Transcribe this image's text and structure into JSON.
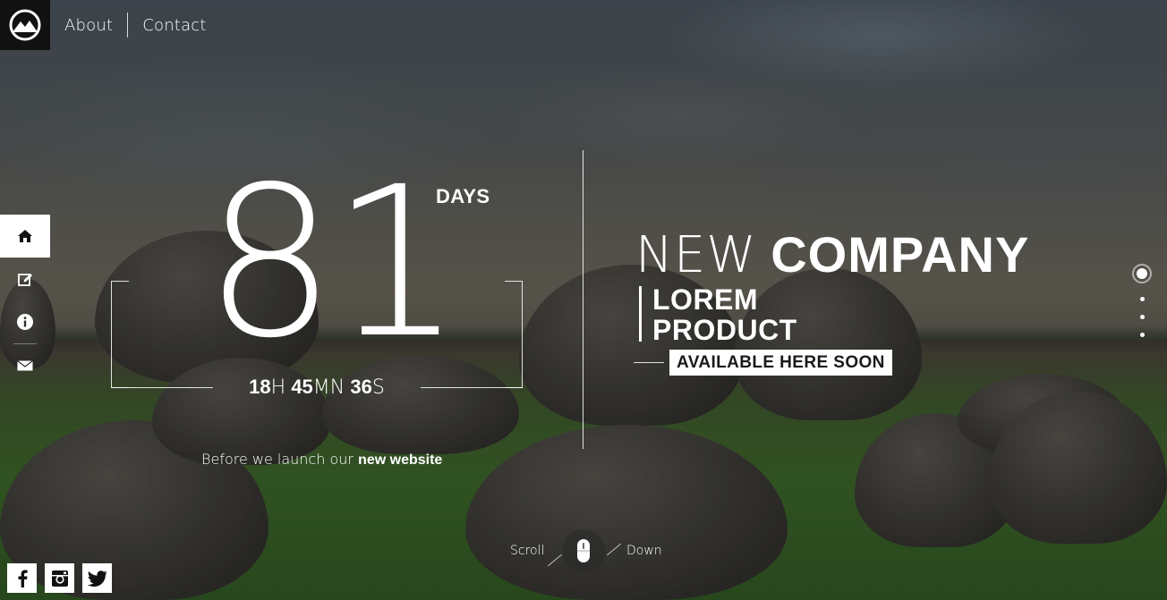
{
  "nav": {
    "about_label": "About",
    "contact_label": "Contact"
  },
  "sidebar": {
    "items": [
      {
        "icon": "home-icon",
        "active": true
      },
      {
        "icon": "edit-icon",
        "active": false
      },
      {
        "icon": "info-icon",
        "active": false
      },
      {
        "icon": "mail-icon",
        "active": false
      }
    ]
  },
  "countdown": {
    "days": "81",
    "days_label": "DAYS",
    "hours": "18",
    "hours_unit": "H",
    "minutes": "45",
    "minutes_unit": "MN",
    "seconds": "36",
    "seconds_unit": "S",
    "launch_prefix": "Before we launch our",
    "launch_emphasis": "new website"
  },
  "headline": {
    "thin": "NEW",
    "bold": "COMPANY",
    "product_line1": "LOREM",
    "product_line2": "PRODUCT",
    "soon": "AVAILABLE HERE SOON"
  },
  "pager": {
    "count": 4,
    "active_index": 0
  },
  "scroll": {
    "left_label": "Scroll",
    "right_label": "Down"
  },
  "social": [
    "facebook-icon",
    "instagram-icon",
    "twitter-icon"
  ],
  "colors": {
    "accent": "#ffffff",
    "dark": "#111111"
  }
}
